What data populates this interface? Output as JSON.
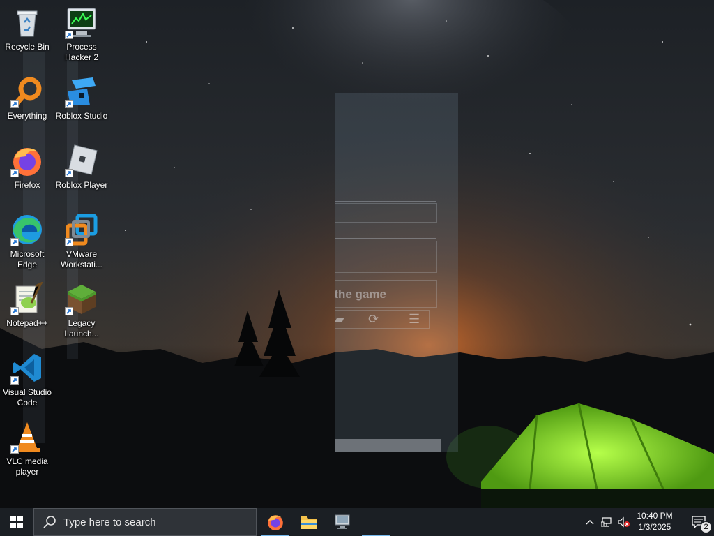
{
  "desktop": {
    "icons": [
      {
        "name": "Recycle Bin",
        "icon": "recycle-bin-icon"
      },
      {
        "name": "Process\nHacker 2",
        "icon": "process-hacker-icon"
      },
      {
        "name": "Everything",
        "icon": "everything-search-icon"
      },
      {
        "name": "Roblox Studio",
        "icon": "roblox-studio-icon"
      },
      {
        "name": "Firefox",
        "icon": "firefox-icon"
      },
      {
        "name": "Roblox Player",
        "icon": "roblox-player-icon"
      },
      {
        "name": "Microsoft\nEdge",
        "icon": "edge-icon"
      },
      {
        "name": "VMware\nWorkstati...",
        "icon": "vmware-icon"
      },
      {
        "name": "Notepad++",
        "icon": "notepadpp-icon"
      },
      {
        "name": "Legacy\nLaunch...",
        "icon": "minecraft-grass-block-icon"
      },
      {
        "name": "Visual Studio\nCode",
        "icon": "vscode-icon"
      },
      {
        "name": "VLC media\nplayer",
        "icon": "vlc-icon"
      }
    ]
  },
  "ghost_window": {
    "partial_text": "r the game"
  },
  "taskbar": {
    "search_placeholder": "Type here to search",
    "pinned_apps": [
      {
        "name": "Firefox",
        "icon": "firefox-icon",
        "active": true
      },
      {
        "name": "File Explorer",
        "icon": "folder-icon",
        "active": false
      },
      {
        "name": "Remote app",
        "icon": "monitor-app-icon",
        "active": true
      }
    ],
    "clock_time": "10:40 PM",
    "clock_date": "1/3/2025",
    "notification_count": "2"
  },
  "colors": {
    "taskbar_bg": "#1b1f24",
    "search_bg": "#2f3338",
    "active_underline": "#76b9ed",
    "tent_green": "#7ed321"
  }
}
